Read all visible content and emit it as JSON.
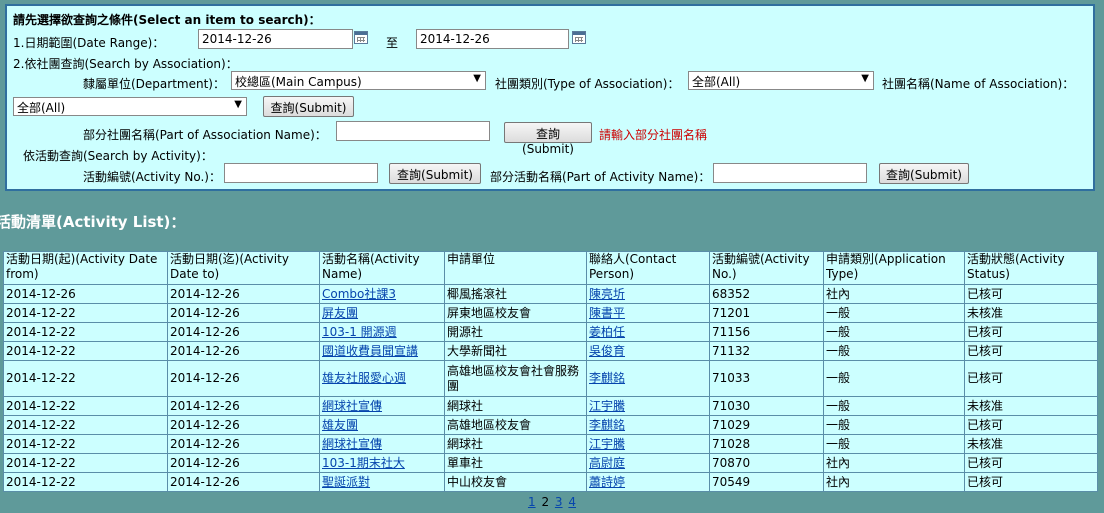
{
  "search": {
    "heading": "請先選擇欲查詢之條件(Select an item to search)：",
    "date_range_label": "1.日期範圍(Date Range)：",
    "date_from": "2014-12-26",
    "to_label": "至",
    "date_to": "2014-12-26",
    "by_association_label": "2.依社團查詢(Search by Association)：",
    "department_label": "隸屬單位(Department)：",
    "department_value": "校總區(Main Campus)",
    "type_label": "社團類別(Type of Association)：",
    "type_value": "全部(All)",
    "name_label": "社團名稱(Name of Association)：",
    "name_value": "全部(All)",
    "submit_label": "查詢(Submit)",
    "part_name_label": "部分社團名稱(Part of Association Name)：",
    "part_name_value": "",
    "part_name_hint": "請輸入部分社團名稱",
    "by_activity_label": "依活動查詢(Search by Activity)：",
    "activity_no_label": "活動編號(Activity No.)：",
    "activity_no_value": "",
    "part_activity_label": "部分活動名稱(Part of Activity Name)：",
    "part_activity_value": ""
  },
  "list": {
    "title": "活動清單(Activity List)：",
    "headers": [
      "活動日期(起)(Activity Date from)",
      "活動日期(迄)(Activity Date to)",
      "活動名稱(Activity Name)",
      "申請單位",
      "聯絡人(Contact Person)",
      "活動編號(Activity No.)",
      "申請類別(Application Type)",
      "活動狀態(Activity Status)"
    ],
    "rows": [
      [
        "2014-12-26",
        "2014-12-26",
        "Combo社課3",
        "椰風搖滾社",
        "陳亮圻",
        "68352",
        "社內",
        "已核可"
      ],
      [
        "2014-12-22",
        "2014-12-26",
        "屏友團",
        "屏東地區校友會",
        "陳書平",
        "71201",
        "一般",
        "未核准"
      ],
      [
        "2014-12-22",
        "2014-12-26",
        "103-1 開源週",
        "開源社",
        "姜柏任",
        "71156",
        "一般",
        "已核可"
      ],
      [
        "2014-12-22",
        "2014-12-26",
        "國道收費員聞宣講",
        "大學新聞社",
        "吳俊育",
        "71132",
        "一般",
        "已核可"
      ],
      [
        "2014-12-22",
        "2014-12-26",
        "雄友社服愛心週",
        "高雄地區校友會社會服務團",
        "李麒銘",
        "71033",
        "一般",
        "已核可"
      ],
      [
        "2014-12-22",
        "2014-12-26",
        "網球社宣傳",
        "網球社",
        "江宇騰",
        "71030",
        "一般",
        "未核准"
      ],
      [
        "2014-12-22",
        "2014-12-26",
        "雄友團",
        "高雄地區校友會",
        "李麒銘",
        "71029",
        "一般",
        "已核可"
      ],
      [
        "2014-12-22",
        "2014-12-26",
        "網球社宣傳",
        "網球社",
        "江宇騰",
        "71028",
        "一般",
        "未核准"
      ],
      [
        "2014-12-22",
        "2014-12-26",
        "103-1期末社大",
        "單車社",
        "高尉庭",
        "70870",
        "社內",
        "已核可"
      ],
      [
        "2014-12-22",
        "2014-12-26",
        "聖誕派對",
        "中山校友會",
        "蕭詩婷",
        "70549",
        "社內",
        "已核可"
      ]
    ]
  },
  "pager": {
    "pages": [
      "1",
      "2",
      "3",
      "4"
    ],
    "current": "2"
  }
}
